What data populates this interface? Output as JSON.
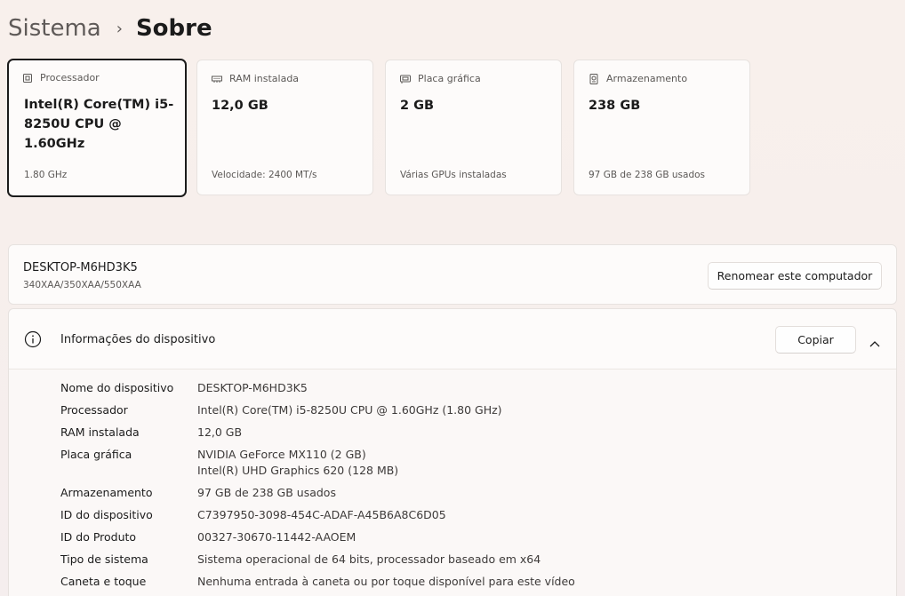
{
  "breadcrumb": {
    "parent": "Sistema",
    "separator": "›",
    "current": "Sobre"
  },
  "cards": [
    {
      "label": "Processador",
      "icon": "cpu-icon",
      "value": "Intel(R) Core(TM) i5-8250U CPU @ 1.60GHz",
      "sub": "1.80 GHz",
      "selected": true
    },
    {
      "label": "RAM instalada",
      "icon": "ram-icon",
      "value": "12,0 GB",
      "sub": "Velocidade: 2400 MT/s"
    },
    {
      "label": "Placa gráfica",
      "icon": "gpu-icon",
      "value": "2 GB",
      "sub": "Várias GPUs instaladas"
    },
    {
      "label": "Armazenamento",
      "icon": "storage-icon",
      "value": "238 GB",
      "sub": "97 GB de 238 GB usados"
    }
  ],
  "device": {
    "name": "DESKTOP-M6HD3K5",
    "model": "340XAA/350XAA/550XAA",
    "rename_label": "Renomear este computador"
  },
  "info": {
    "title": "Informações do dispositivo",
    "copy_label": "Copiar",
    "rows": [
      {
        "key": "Nome do dispositivo",
        "value": "DESKTOP-M6HD3K5"
      },
      {
        "key": "Processador",
        "value": "Intel(R) Core(TM) i5-8250U CPU @ 1.60GHz   (1.80 GHz)"
      },
      {
        "key": "RAM instalada",
        "value": "12,0 GB"
      },
      {
        "key": "Placa gráfica",
        "value": "NVIDIA GeForce MX110 (2 GB)",
        "value2": "Intel(R) UHD Graphics 620 (128 MB)"
      },
      {
        "key": "Armazenamento",
        "value": "97 GB de 238 GB usados"
      },
      {
        "key": "ID do dispositivo",
        "value": "C7397950-3098-454C-ADAF-A45B6A8C6D05"
      },
      {
        "key": "ID do Produto",
        "value": "00327-30670-11442-AAOEM"
      },
      {
        "key": "Tipo de sistema",
        "value": "Sistema operacional de 64 bits, processador baseado em x64"
      },
      {
        "key": "Caneta e toque",
        "value": "Nenhuma entrada à caneta ou por toque disponível para este vídeo"
      }
    ]
  }
}
